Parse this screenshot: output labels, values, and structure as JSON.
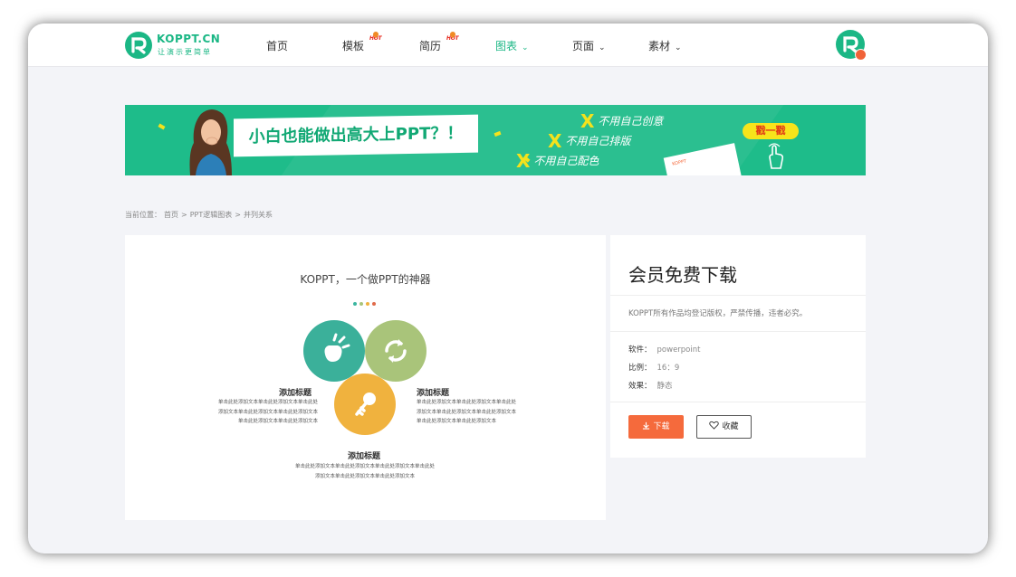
{
  "brand": {
    "name": "KOPPT.CN",
    "slogan": "让演示更简单",
    "color": "#1bb785"
  },
  "nav": {
    "items": [
      {
        "label": "首页",
        "active": false
      },
      {
        "label": "模板",
        "badge": "HOT"
      },
      {
        "label": "简历",
        "badge": "HOT"
      },
      {
        "label": "图表",
        "active": true
      },
      {
        "label": "页面"
      },
      {
        "label": "素材"
      }
    ],
    "caret": "⌄"
  },
  "banner": {
    "headline": "小白也能做出高大上PPT？！",
    "features": [
      "不用自己创意",
      "不用自己排版",
      "不用自己配色"
    ],
    "button": "戳一戳",
    "paper_text": "KOPPT"
  },
  "breadcrumb": {
    "prefix": "当前位置：",
    "items": [
      "首页",
      "PPT逻辑图表",
      "并列关系"
    ],
    "separator": ">"
  },
  "preview": {
    "title": "KOPPT，一个做PPT的神器",
    "dot_colors": [
      "#3bb6a0",
      "#a9c47a",
      "#f0b23e",
      "#e06a4a"
    ],
    "bubbles": [
      {
        "color": "#3bb09a",
        "icon": "hand-icon"
      },
      {
        "color": "#a9c47a",
        "icon": "refresh-icon"
      },
      {
        "color": "#f0b23e",
        "icon": "key-icon"
      }
    ],
    "blocks": [
      {
        "title": "添加标题",
        "text": "单击此处添加文本单击此处添加文本单击此处添加文本单击此处添加文本单击此处添加文本单击此处添加文本单击此处添加文本"
      },
      {
        "title": "添加标题",
        "text": "单击此处添加文本单击此处添加文本单击此处添加文本单击此处添加文本单击此处添加文本单击此处添加文本单击此处添加文本"
      },
      {
        "title": "添加标题",
        "text_line1": "单击此处添加文本单击此处添加文本单击此处添加文本单击此处",
        "text_line2": "添加文本单击此处添加文本单击此处添加文本"
      }
    ]
  },
  "panel": {
    "title": "会员免费下载",
    "note": "KOPPT所有作品均登记版权，严禁传播，违者必究。",
    "meta": [
      {
        "key": "软件：",
        "value": "powerpoint"
      },
      {
        "key": "比例：",
        "value": "16：9"
      },
      {
        "key": "效果：",
        "value": "静态"
      }
    ],
    "download_label": "下载",
    "favorite_label": "收藏",
    "download_color": "#f56a3c"
  }
}
